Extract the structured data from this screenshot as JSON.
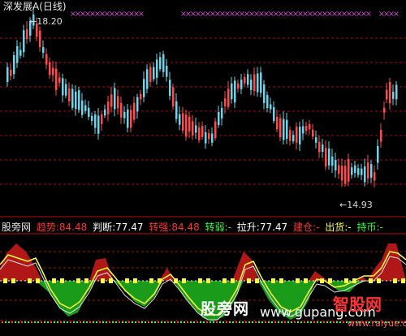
{
  "title": "深发展A(日线)",
  "price_high_label": "18.20",
  "price_low_label": "14.93",
  "indicator_name": "股旁网",
  "indicators": [
    {
      "label": "趋势:",
      "value": "84.48",
      "label_color": "#ff3333",
      "value_color": "#ff3333"
    },
    {
      "label": "判断:",
      "value": "77.47",
      "label_color": "#ffffff",
      "value_color": "#ffffff"
    },
    {
      "label": "转强:",
      "value": "84.48",
      "label_color": "#ff3333",
      "value_color": "#ff3333"
    },
    {
      "label": "转弱:",
      "value": "-",
      "label_color": "#33ff33",
      "value_color": "#33ff33"
    },
    {
      "label": "拉升:",
      "value": "77.47",
      "label_color": "#ffffff",
      "value_color": "#ffffff"
    },
    {
      "label": "建仓:",
      "value": "-",
      "label_color": "#ff3333",
      "value_color": "#ff3333"
    },
    {
      "label": "出货:",
      "value": "-",
      "label_color": "#ffff33",
      "value_color": "#ffff33"
    },
    {
      "label": "持币:",
      "value": "-",
      "label_color": "#33ff33",
      "value_color": "#33ff33"
    }
  ],
  "watermark": {
    "site_cn": "股旁网",
    "site_url": "www.gupang.com",
    "brand": "智股网",
    "brand_url": "www.raiyue.com"
  },
  "colors": {
    "up": "#ff4b4b",
    "down": "#6fd3e8",
    "grid": "#a01010",
    "bull_fill": "#b01818",
    "bear_fill": "#1a9b1a",
    "line_yellow": "#ffff40",
    "marker_magenta": "#d44ad4"
  }
}
